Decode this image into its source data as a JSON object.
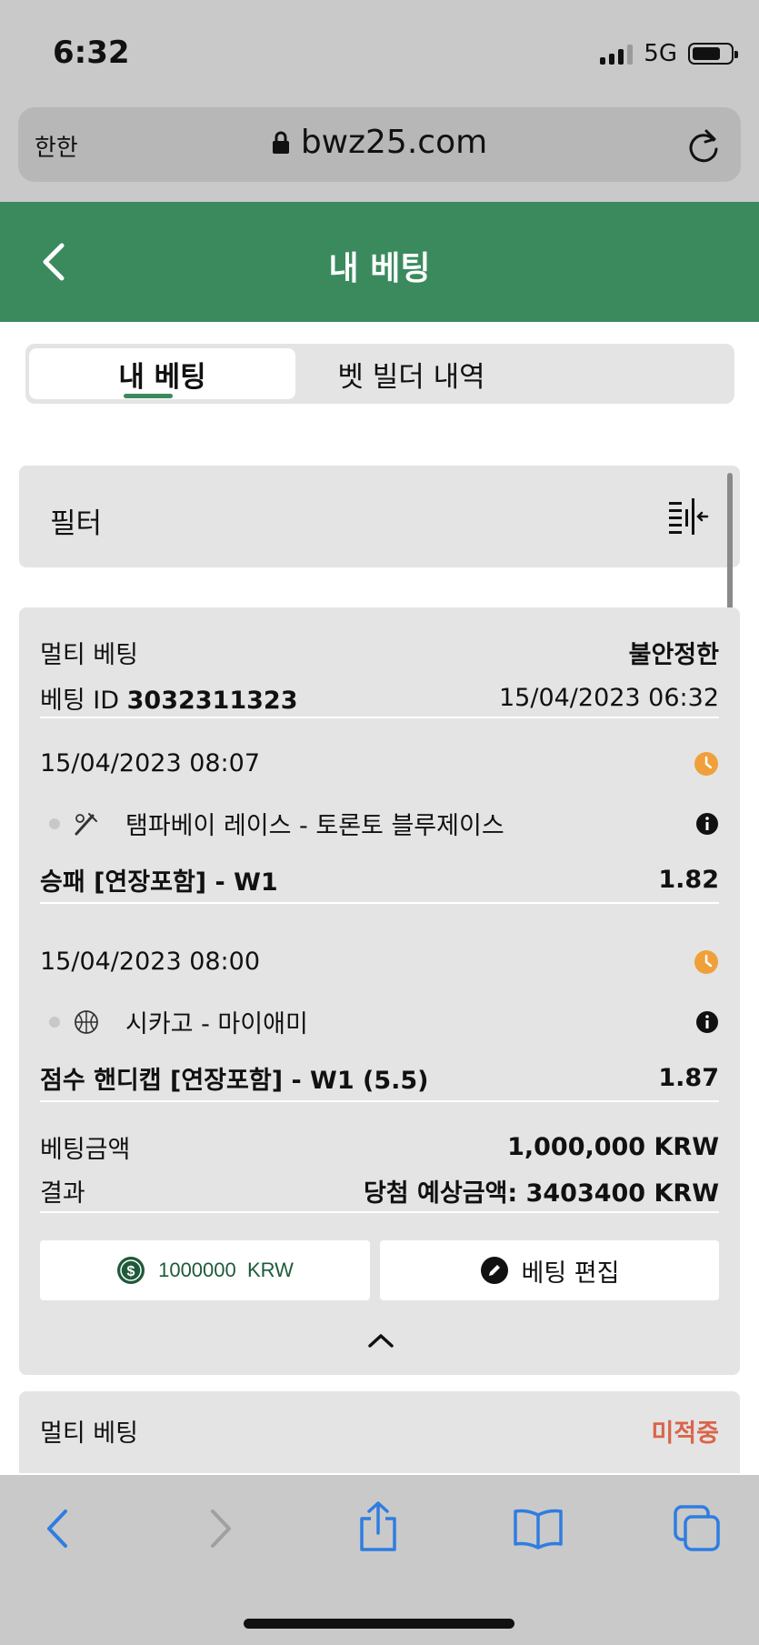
{
  "status_bar": {
    "time": "6:32",
    "network": "5G",
    "battery_level": 0.75
  },
  "browser": {
    "lang_button": "한한",
    "url": "bwz25.com"
  },
  "header": {
    "title": "내 베팅"
  },
  "tabs": [
    {
      "label": "내 베팅",
      "active": true
    },
    {
      "label": "벳 빌더 내역",
      "active": false
    }
  ],
  "filter": {
    "label": "필터"
  },
  "bet": {
    "type": "멀티 베팅",
    "status": "불안정한",
    "id_label": "베팅 ID",
    "id_value": "3032311323",
    "placed_at": "15/04/2023 06:32",
    "selections": [
      {
        "datetime": "15/04/2023 08:07",
        "sport_icon": "baseball-icon",
        "match": "탬파베이 레이스 - 토론토 블루제이스",
        "market": "승패 [연장포함] - W1",
        "odds": "1.82"
      },
      {
        "datetime": "15/04/2023 08:00",
        "sport_icon": "basketball-icon",
        "match": "시카고 - 마이애미",
        "market": "점수 핸디캡 [연장포함] - W1 (5.5)",
        "odds": "1.87"
      }
    ],
    "stake_label": "베팅금액",
    "stake_value": "1,000,000 KRW",
    "result_label": "결과",
    "result_value": "당첨 예상금액: 3403400 KRW",
    "stake_button": "1000000  KRW",
    "edit_button": "베팅 편집"
  },
  "bet2": {
    "type": "멀티 베팅",
    "status": "미적중"
  },
  "colors": {
    "header_green": "#3a8a5e",
    "pending_orange": "#f0a03a",
    "unmatched_red": "#d9654a",
    "safari_blue": "#2f7de1"
  }
}
